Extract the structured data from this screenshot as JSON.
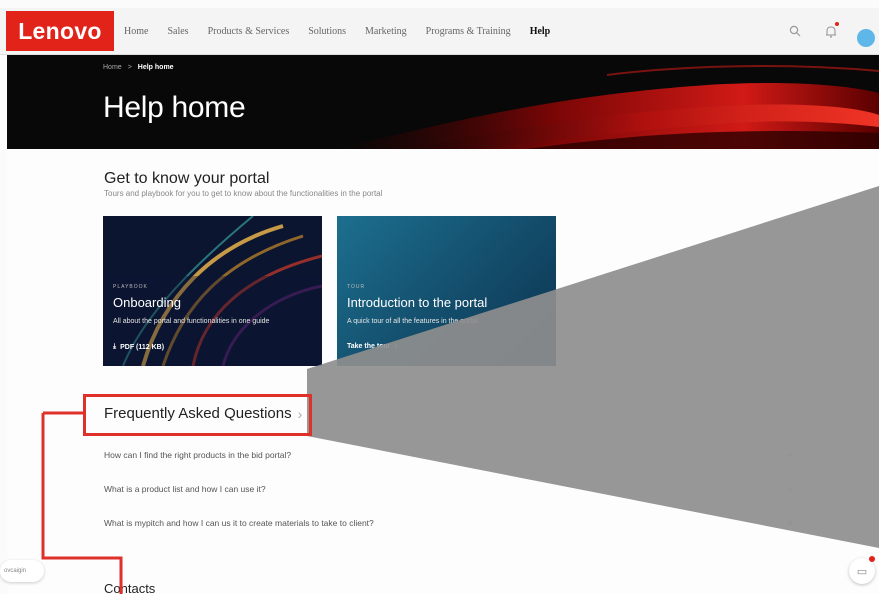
{
  "nav": {
    "logo": "Lenovo",
    "items": [
      "Home",
      "Sales",
      "Products & Services",
      "Solutions",
      "Marketing",
      "Programs & Training",
      "Help"
    ],
    "active_index": 6,
    "icons": [
      "search-icon",
      "bell-icon",
      "avatar"
    ]
  },
  "hero": {
    "breadcrumb": {
      "home": "Home",
      "separator": ">",
      "current": "Help home"
    },
    "title": "Help home"
  },
  "portal": {
    "title": "Get to know your portal",
    "subtitle": "Tours and playbook for you to get to know about the functionalities in the portal",
    "cards": [
      {
        "kicker": "PLAYBOOK",
        "title": "Onboarding",
        "description": "All about the portal and functionalities in one guide",
        "action": "PDF (112 KB)",
        "action_icon": "download-icon"
      },
      {
        "kicker": "TOUR",
        "title": "Introduction to the portal",
        "description": "A quick tour of all the features in the portal",
        "action": "Take the tour",
        "action_icon": "chevron-right-icon"
      }
    ]
  },
  "faq": {
    "title": "Frequently Asked Questions",
    "chevron": "›",
    "items": [
      "How can I find the right products in the bid portal?",
      "What is a product list and how I can use it?",
      "What is mypitch and how I can us it to create materials to take to client?"
    ],
    "expand_symbol": "+"
  },
  "contacts": {
    "title": "Contacts"
  },
  "chat": {
    "pill_label": "ovcaigin",
    "button_icon": "chat-icon"
  },
  "colors": {
    "brand": "#e2231a",
    "highlight": "#e0302a",
    "overlay": "#8e8e8e",
    "tour_card": "#1d6f8f"
  }
}
